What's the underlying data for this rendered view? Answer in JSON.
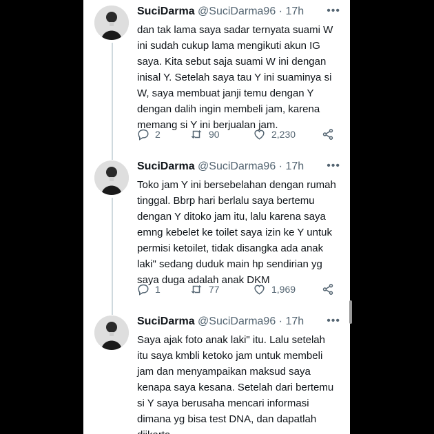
{
  "tweets": [
    {
      "name": "SuciDarma",
      "handle": "@SuciDarma96",
      "separator": "·",
      "time": "17h",
      "more": "•••",
      "text": "dan tak lama saya sadar ternyata suami W\nini sudah cukup lama mengikuti akun IG\nsaya. Kita sebut saja suami W ini dengan\ninisal Y. Setelah saya tau Y ini suaminya si\nW, saya membuat janji temu dengan Y\ndengan dalih ingin membeli jam, karena\nmemang si Y ini berjualan jam.",
      "replies": "2",
      "retweets": "90",
      "likes": "2,230"
    },
    {
      "name": "SuciDarma",
      "handle": "@SuciDarma96",
      "separator": "·",
      "time": "17h",
      "more": "•••",
      "text": "Toko jam Y ini bersebelahan dengan rumah\ntinggal. Bbrp hari berlalu saya bertemu\ndengan Y ditoko jam itu, lalu karena saya\nemng kebelet ke toilet saya izin ke Y untuk\npermisi ketoilet, tidak disangka ada anak\nlaki\" sedang duduk main hp sendirian yg\nsaya duga adalah anak DKM",
      "replies": "1",
      "retweets": "77",
      "likes": "1,969"
    },
    {
      "name": "SuciDarma",
      "handle": "@SuciDarma96",
      "separator": "·",
      "time": "17h",
      "more": "•••",
      "text": "Saya ajak foto anak laki\" itu. Lalu setelah\nitu saya kmbli ketoko jam untuk membeli\njam dan menyampaikan maksud saya\nkenapa saya kesana. Setelah dari bertemu\nsi Y saya berusaha mencari informasi\ndimana yg bisa test DNA, dan dapatlah\ndijkarta."
    }
  ]
}
